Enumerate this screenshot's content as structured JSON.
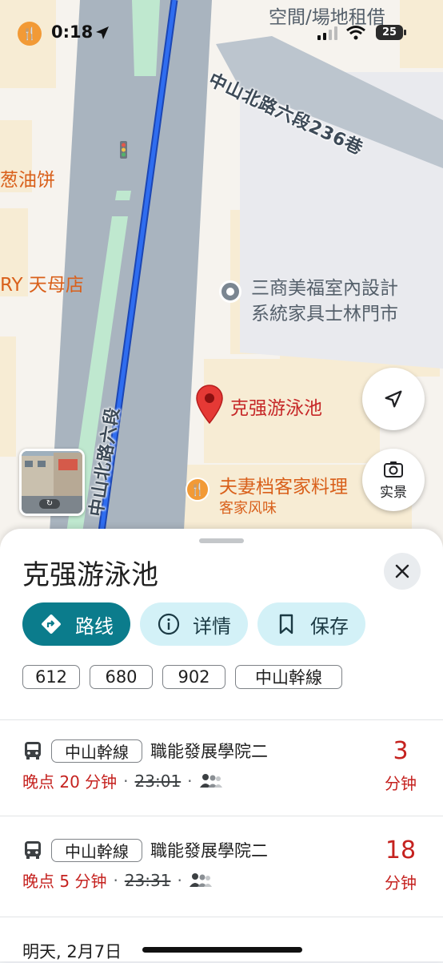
{
  "status_bar": {
    "time": "0:18",
    "battery": "25"
  },
  "map": {
    "pois": {
      "space_rental": "空間/場地租借",
      "onion_pancake": "葱油饼",
      "tianmu_store": "RY 天母店",
      "furniture_line1": "三商美福室內設計",
      "furniture_line2": "系統家具士林門市",
      "pool": "克强游泳池",
      "restaurant": "夫妻档客家料理",
      "restaurant_sub": "客家风味"
    },
    "streets": {
      "lane": "中山北路六段236巷",
      "main": "中山北路六段"
    },
    "live_view_label": "实景"
  },
  "sheet": {
    "title": "克强游泳池",
    "buttons": {
      "route": "路线",
      "details": "详情",
      "save": "保存"
    },
    "bus_chips": [
      "612",
      "680",
      "902",
      "中山幹線"
    ],
    "departures": [
      {
        "route": "中山幹線",
        "destination": "職能發展學院二",
        "delay": "晚点 20 分钟",
        "scheduled": "23:01",
        "eta_value": "3",
        "eta_unit": "分钟"
      },
      {
        "route": "中山幹線",
        "destination": "職能發展學院二",
        "delay": "晚点 5 分钟",
        "scheduled": "23:31",
        "eta_value": "18",
        "eta_unit": "分钟"
      }
    ],
    "tomorrow": "明天, 2月7日"
  },
  "colors": {
    "accent": "#0b7c8c",
    "late": "#c5221f",
    "route_line": "#1a56db"
  }
}
